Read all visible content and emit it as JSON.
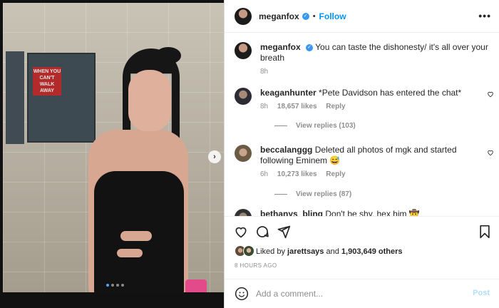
{
  "post": {
    "username": "meganfox",
    "separator": "•",
    "follow_label": "Follow",
    "more_label": "•••",
    "photo_nav": "›",
    "caption_text": "You can taste the dishonesty/ it's all over your breath",
    "caption_time": "8h"
  },
  "comments": [
    {
      "username": "keaganhunter",
      "text": "*Pete Davidson has entered the chat*",
      "time": "8h",
      "likes": "18,657 likes",
      "reply_label": "Reply",
      "view_replies": "View replies (103)"
    },
    {
      "username": "beccalanggg",
      "text": "Deleted all photos of mgk and started following Eminem 😅",
      "time": "6h",
      "likes": "10,273 likes",
      "reply_label": "Reply",
      "view_replies": "View replies (87)"
    },
    {
      "username": "bethanys_bling",
      "text": "Don't be shy, hex him 🤠"
    }
  ],
  "likes": {
    "prefix": "Liked by",
    "user": "jarettsays",
    "conj": "and",
    "count": "1,903,649 others"
  },
  "time_ago": "8 HOURS AGO",
  "add_comment": {
    "placeholder": "Add a comment...",
    "post_label": "Post"
  },
  "poster": {
    "text": "WHEN YOU CAN'T WALK AWAY"
  },
  "carousel": {
    "count": 4,
    "active_index": 0
  },
  "colors": {
    "accent": "#0095f6",
    "verified": "#3897f0",
    "muted": "#8e8e8e",
    "post_disabled": "#b2dffc"
  },
  "icons": [
    "heart-icon",
    "comment-icon",
    "share-icon",
    "bookmark-icon",
    "emoji-icon",
    "more-icon",
    "verified-icon",
    "chevron-right-icon"
  ]
}
